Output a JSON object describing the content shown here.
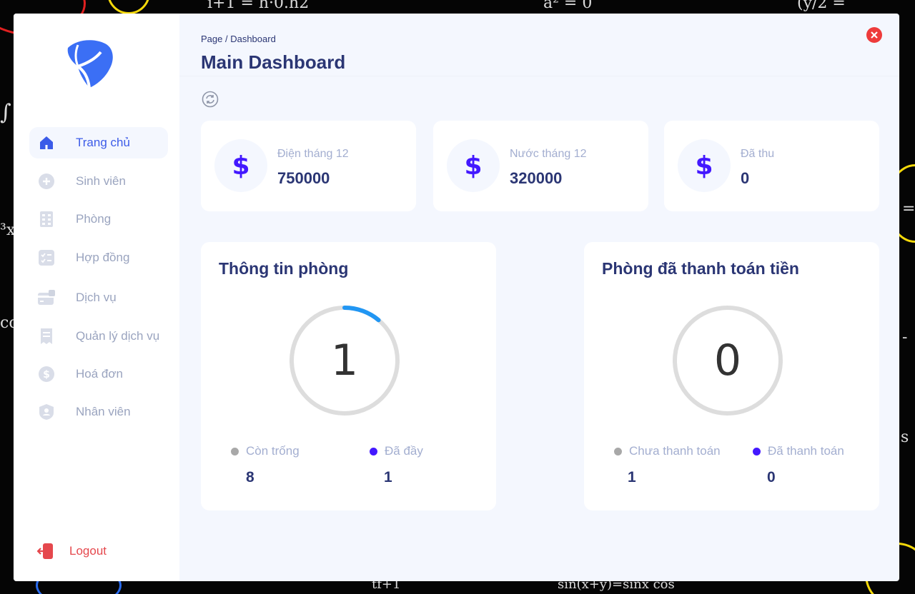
{
  "breadcrumb": "Page / Dashboard",
  "page_title": "Main Dashboard",
  "sidebar": {
    "items": [
      {
        "label": "Trang chủ",
        "icon": "home-icon",
        "active": true
      },
      {
        "label": "Sinh viên",
        "icon": "plus-circle-icon",
        "active": false
      },
      {
        "label": "Phòng",
        "icon": "building-icon",
        "active": false
      },
      {
        "label": "Hợp đồng",
        "icon": "checklist-icon",
        "active": false
      },
      {
        "label": "Dịch vụ",
        "icon": "card-icon",
        "active": false
      },
      {
        "label": "Quản lý dịch vụ",
        "icon": "receipt-icon",
        "active": false
      },
      {
        "label": "Hoá đơn",
        "icon": "dollar-circle-icon",
        "active": false
      },
      {
        "label": "Nhân viên",
        "icon": "user-badge-icon",
        "active": false
      }
    ],
    "logout_label": "Logout"
  },
  "stats": [
    {
      "label": "Điện tháng 12",
      "value": "750000",
      "icon": "$"
    },
    {
      "label": "Nước tháng 12",
      "value": "320000",
      "icon": "$"
    },
    {
      "label": "Đã thu",
      "value": "0",
      "icon": "$"
    }
  ],
  "panels": [
    {
      "title": "Thông tin phòng",
      "center_value": "1",
      "progress_fraction": 0.111,
      "legend": [
        {
          "label": "Còn trống",
          "count": "8",
          "color": "#a8a8a8"
        },
        {
          "label": "Đã đầy",
          "count": "1",
          "color": "#4318ff"
        }
      ]
    },
    {
      "title": "Phòng đã thanh toán tiền",
      "center_value": "0",
      "progress_fraction": 0,
      "legend": [
        {
          "label": "Chưa thanh toán",
          "count": "1",
          "color": "#a8a8a8"
        },
        {
          "label": "Đã thanh toán",
          "count": "0",
          "color": "#4318ff"
        }
      ]
    }
  ],
  "colors": {
    "accent": "#4318ff",
    "title": "#2b3674",
    "muted": "#a3aed0",
    "ring_progress": "#2196f3",
    "ring_track": "#dddddd",
    "danger": "#e5484d"
  }
}
